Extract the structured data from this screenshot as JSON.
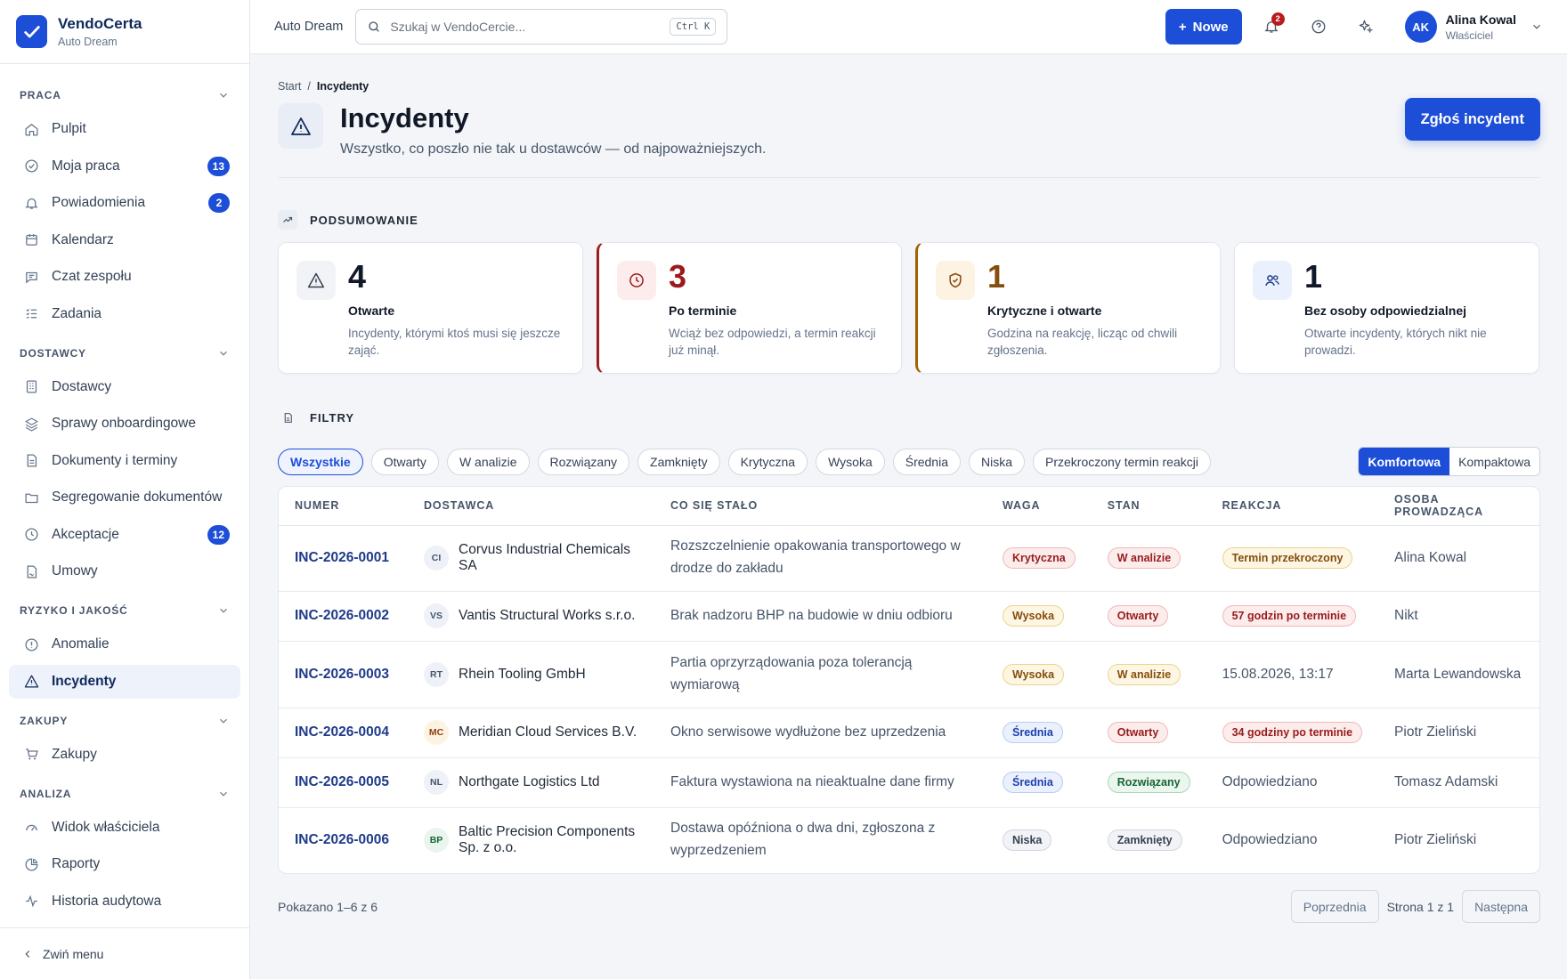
{
  "brand": {
    "name": "VendoCerta",
    "workspace": "Auto Dream"
  },
  "topbar": {
    "workspace": "Auto Dream",
    "search_placeholder": "Szukaj w VendoCercie...",
    "search_shortcut": "Ctrl K",
    "new_label": "Nowe",
    "notif_count": "2",
    "user": {
      "initials": "AK",
      "name": "Alina Kowal",
      "role": "Właściciel"
    }
  },
  "sidebar": {
    "sections": {
      "praca": "PRACA",
      "dostawcy": "DOSTAWCY",
      "ryzyko": "RYZYKO I JAKOŚĆ",
      "zakupy": "ZAKUPY",
      "analiza": "ANALIZA"
    },
    "items": {
      "pulpit": "Pulpit",
      "moja_praca": "Moja praca",
      "moja_praca_count": "13",
      "powiadomienia": "Powiadomienia",
      "powiadomienia_count": "2",
      "kalendarz": "Kalendarz",
      "czat": "Czat zespołu",
      "zadania": "Zadania",
      "dostawcy": "Dostawcy",
      "onboarding": "Sprawy onboardingowe",
      "dokumenty": "Dokumenty i terminy",
      "segregowanie": "Segregowanie dokumentów",
      "akceptacje": "Akceptacje",
      "akceptacje_count": "12",
      "umowy": "Umowy",
      "anomalie": "Anomalie",
      "incydenty": "Incydenty",
      "zakupy": "Zakupy",
      "widok": "Widok właściciela",
      "raporty": "Raporty",
      "historia": "Historia audytowa"
    },
    "collapse": "Zwiń menu"
  },
  "page": {
    "breadcrumb_root": "Start",
    "breadcrumb_sep": "/",
    "breadcrumb_current": "Incydenty",
    "title": "Incydenty",
    "subtitle": "Wszystko, co poszło nie tak u dostawców — od najpoważniejszych.",
    "report_button": "Zgłoś incydent"
  },
  "summary": {
    "heading": "PODSUMOWANIE",
    "cards": [
      {
        "value": "4",
        "title": "Otwarte",
        "desc": "Incydenty, którymi ktoś musi się jeszcze zająć."
      },
      {
        "value": "3",
        "title": "Po terminie",
        "desc": "Wciąż bez odpowiedzi, a termin reakcji już minął."
      },
      {
        "value": "1",
        "title": "Krytyczne i otwarte",
        "desc": "Godzina na reakcję, licząc od chwili zgłoszenia."
      },
      {
        "value": "1",
        "title": "Bez osoby odpowiedzialnej",
        "desc": "Otwarte incydenty, których nikt nie prowadzi."
      }
    ]
  },
  "filters": {
    "heading": "FILTRY",
    "chips": [
      "Wszystkie",
      "Otwarty",
      "W analizie",
      "Rozwiązany",
      "Zamknięty",
      "Krytyczna",
      "Wysoka",
      "Średnia",
      "Niska",
      "Przekroczony termin reakcji"
    ],
    "density": [
      "Komfortowa",
      "Kompaktowa"
    ]
  },
  "table": {
    "headers": [
      "NUMER",
      "DOSTAWCA",
      "CO SIĘ STAŁO",
      "WAGA",
      "STAN",
      "REAKCJA",
      "OSOBA PROWADZĄCA"
    ],
    "rows": [
      {
        "num": "INC-2026-0001",
        "initials": "CI",
        "vendor": "Corvus Industrial Chemicals SA",
        "what": "Rozszczelnienie opakowania transportowego w drodze do zakładu",
        "weight": "Krytyczna",
        "state": "W analizie",
        "reaction": "Termin przekroczony",
        "owner": "Alina Kowal"
      },
      {
        "num": "INC-2026-0002",
        "initials": "VS",
        "vendor": "Vantis Structural Works s.r.o.",
        "what": "Brak nadzoru BHP na budowie w dniu odbioru",
        "weight": "Wysoka",
        "state": "Otwarty",
        "reaction": "57 godzin po terminie",
        "owner": "Nikt"
      },
      {
        "num": "INC-2026-0003",
        "initials": "RT",
        "vendor": "Rhein Tooling GmbH",
        "what": "Partia oprzyrządowania poza tolerancją wymiarową",
        "weight": "Wysoka",
        "state": "W analizie",
        "reaction": "15.08.2026, 13:17",
        "owner": "Marta Lewandowska"
      },
      {
        "num": "INC-2026-0004",
        "initials": "MC",
        "vendor": "Meridian Cloud Services B.V.",
        "what": "Okno serwisowe wydłużone bez uprzedzenia",
        "weight": "Średnia",
        "state": "Otwarty",
        "reaction": "34 godziny po terminie",
        "owner": "Piotr Zieliński"
      },
      {
        "num": "INC-2026-0005",
        "initials": "NL",
        "vendor": "Northgate Logistics Ltd",
        "what": "Faktura wystawiona na nieaktualne dane firmy",
        "weight": "Średnia",
        "state": "Rozwiązany",
        "reaction": "Odpowiedziano",
        "owner": "Tomasz Adamski"
      },
      {
        "num": "INC-2026-0006",
        "initials": "BP",
        "vendor": "Baltic Precision Components Sp. z o.o.",
        "what": "Dostawa opóźniona o dwa dni, zgłoszona z wyprzedzeniem",
        "weight": "Niska",
        "state": "Zamknięty",
        "reaction": "Odpowiedziano",
        "owner": "Piotr Zieliński"
      }
    ]
  },
  "footer": {
    "showing": "Pokazano 1–6 z 6",
    "prev": "Poprzednia",
    "page": "Strona 1 z 1",
    "next": "Następna"
  },
  "colors": {
    "accent": "#1d4ed8",
    "navy": "#0f2a5c",
    "danger": "#991b1b",
    "warning": "#854d0e"
  }
}
